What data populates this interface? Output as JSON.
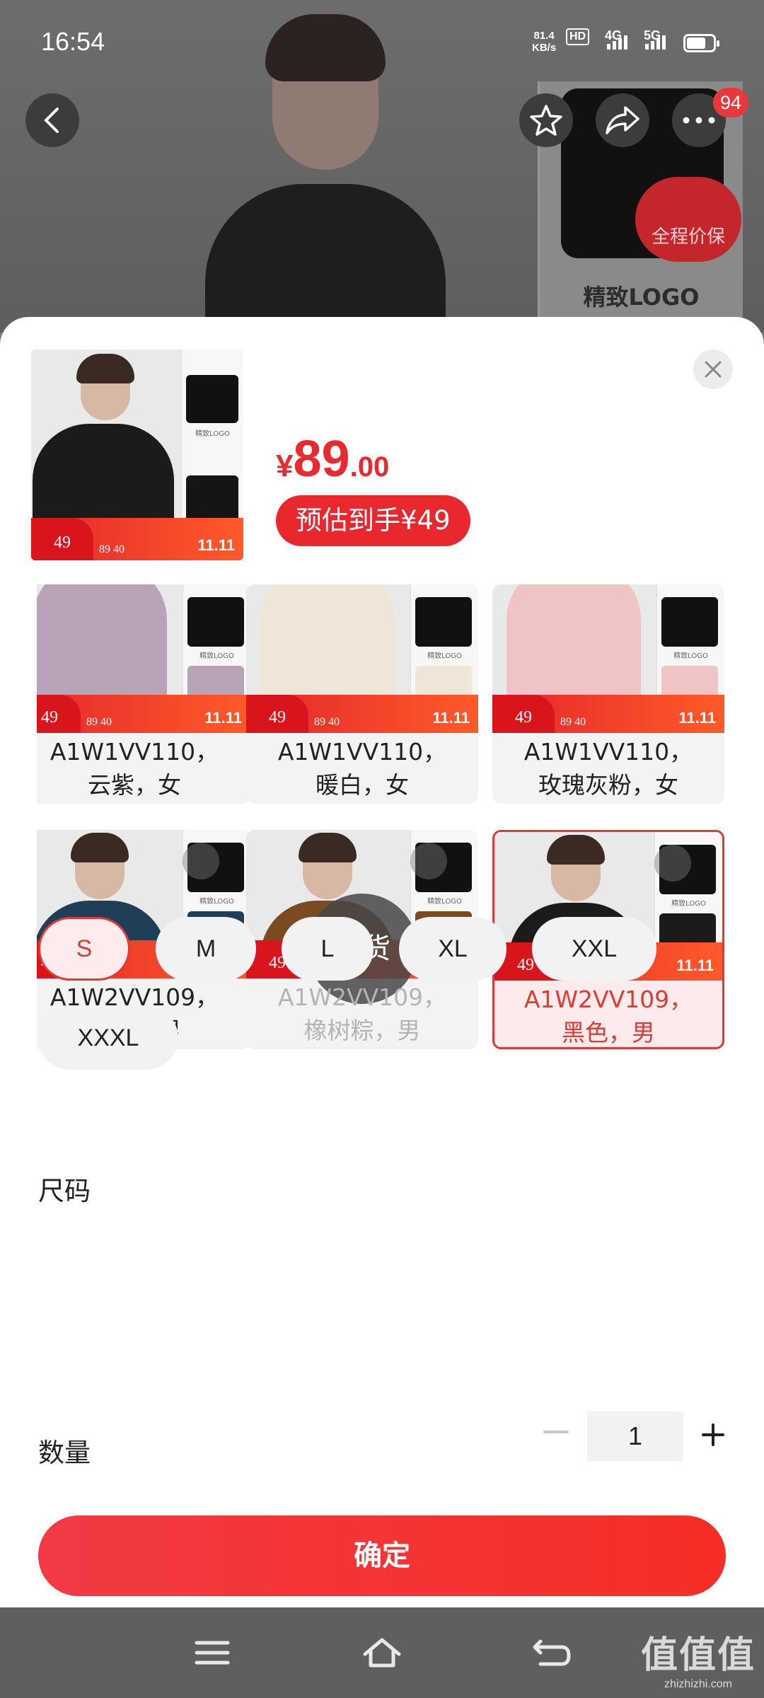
{
  "status": {
    "time": "16:54",
    "speed_value": "81.4",
    "speed_unit": "KB/s",
    "hd": "HD",
    "sim1": "1",
    "sim2": "2",
    "g4": "4G",
    "g5": "5G"
  },
  "header": {
    "cart_count": "94",
    "bg_thumb_badge": "全程价保",
    "bg_thumb_caption": "精致LOGO"
  },
  "product": {
    "currency": "¥",
    "price_int": "89",
    "price_dec": ".00",
    "estimate": "预估到手¥49"
  },
  "promo": {
    "price": "49",
    "mid": "89   40",
    "eleven": "11.11"
  },
  "variants": [
    {
      "label": "A1W1VV110，\n云紫，女",
      "color": "#b7a4b8",
      "state": "normal"
    },
    {
      "label": "A1W1VV110，\n暖白，女",
      "color": "#efe6d7",
      "state": "normal"
    },
    {
      "label": "A1W1VV110，\n玫瑰灰粉，女",
      "color": "#f0c3c4",
      "state": "normal"
    },
    {
      "label": "A1W2VV109，\n暮蓝，男",
      "color": "#1f3e57",
      "state": "normal"
    },
    {
      "label": "A1W2VV109，\n橡树粽，男",
      "color": "#7a4a23",
      "state": "disabled",
      "overlay": "无货"
    },
    {
      "label": "A1W2VV109，\n黑色，男",
      "color": "#1b1b1b",
      "state": "selected"
    }
  ],
  "sizes": {
    "title": "尺码",
    "options": [
      "S",
      "M",
      "L",
      "XL",
      "XXL",
      "XXXL"
    ],
    "selected": "S"
  },
  "quantity": {
    "title": "数量",
    "value": "1"
  },
  "confirm_label": "确定",
  "watermark": {
    "big": "值值值",
    "small": "zhizhizhi.com"
  },
  "colors": {
    "accent": "#df3b36",
    "button": "#f23a45"
  },
  "icons": [
    "back-icon",
    "favorite-icon",
    "share-icon",
    "more-icon",
    "close-icon",
    "menu-icon",
    "home-icon",
    "return-icon"
  ]
}
